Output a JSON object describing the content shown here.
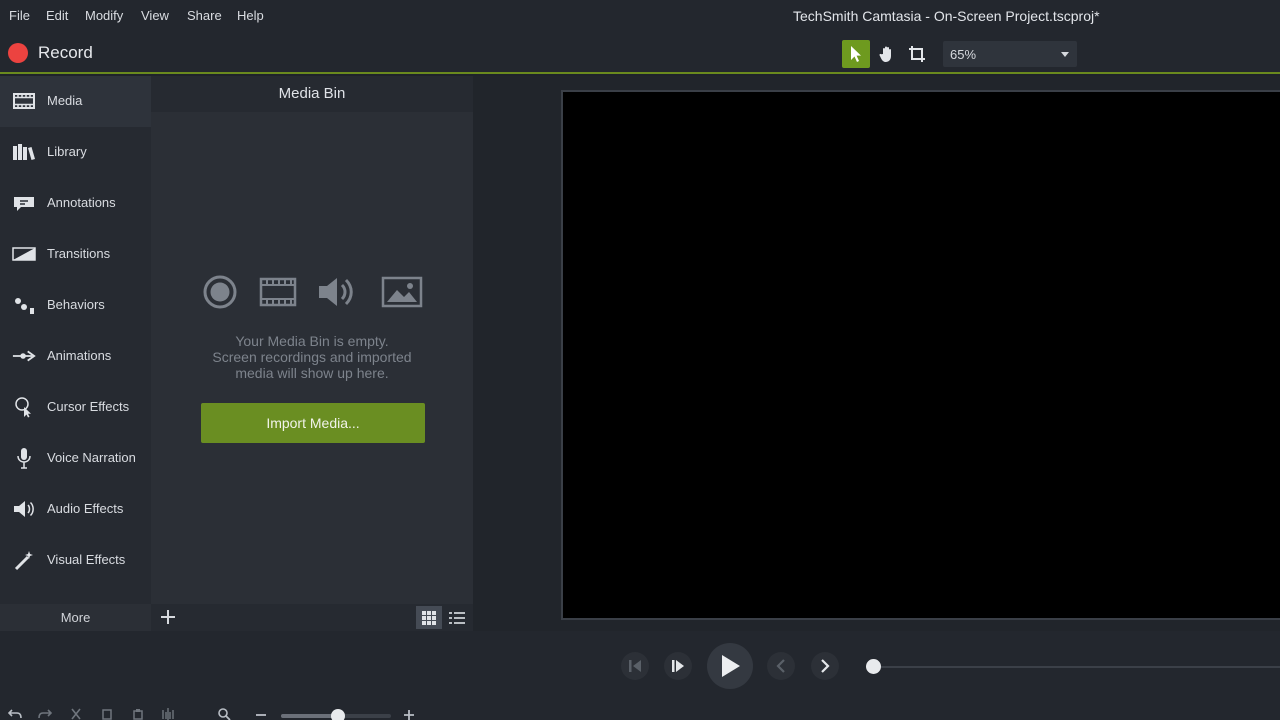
{
  "menu": [
    "File",
    "Edit",
    "Modify",
    "View",
    "Share",
    "Help"
  ],
  "app_title": "TechSmith Camtasia - On-Screen Project.tscproj*",
  "toolbar": {
    "record_label": "Record",
    "tools": [
      "select-pointer-icon",
      "pan-hand-icon",
      "crop-icon"
    ],
    "zoom_level": "65%",
    "accent_color": "#6e9a1f",
    "record_color": "#ec4340"
  },
  "tabs": [
    {
      "label": "Media",
      "icon": "film-strip-icon",
      "active": true
    },
    {
      "label": "Library",
      "icon": "library-books-icon"
    },
    {
      "label": "Annotations",
      "icon": "annotation-callout-icon"
    },
    {
      "label": "Transitions",
      "icon": "transition-icon"
    },
    {
      "label": "Behaviors",
      "icon": "behaviors-icon"
    },
    {
      "label": "Animations",
      "icon": "animation-arrow-icon"
    },
    {
      "label": "Cursor Effects",
      "icon": "cursor-effects-icon"
    },
    {
      "label": "Voice Narration",
      "icon": "microphone-icon"
    },
    {
      "label": "Audio Effects",
      "icon": "speaker-icon"
    },
    {
      "label": "Visual Effects",
      "icon": "magic-wand-icon"
    }
  ],
  "more_label": "More",
  "media_bin": {
    "title": "Media Bin",
    "empty_lines": [
      "Your Media Bin is empty.",
      "Screen recordings and imported",
      "media will show up here."
    ],
    "import_label": "Import Media...",
    "import_color": "#6a8e22",
    "view_mode": "grid"
  },
  "playback": {
    "controls": [
      "step-back-icon",
      "step-forward-icon",
      "play-icon",
      "previous-marker-icon",
      "next-marker-icon"
    ]
  },
  "timeline_tools": [
    "undo-icon",
    "redo-icon",
    "cut-icon",
    "copy-icon",
    "paste-icon",
    "split-icon",
    "zoom-magnifier-icon",
    "zoom-out-icon",
    "zoom-in-icon"
  ]
}
